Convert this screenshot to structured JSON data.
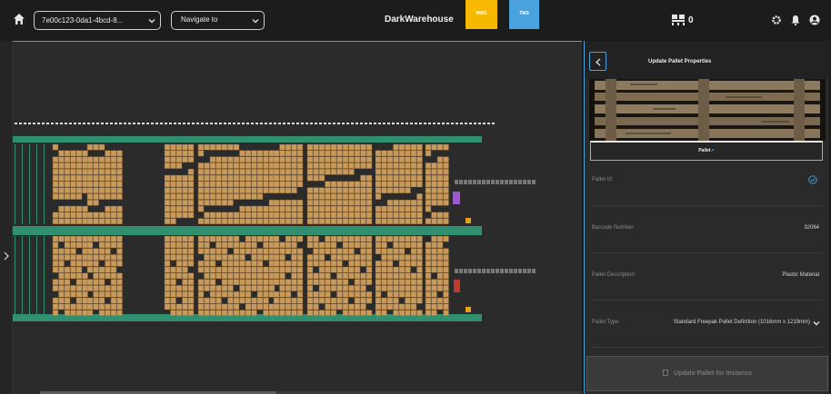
{
  "header": {
    "warehouse_select_value": "7e00c123-0da1-4bcd-8...",
    "navigate_placeholder": "Navigate to",
    "app_title": "DarkWarehouse",
    "wms_label": "WMS",
    "tms_label": "TMS",
    "pallet_count": "0",
    "colors": {
      "wms": "#f6b900",
      "tms": "#4aa3df",
      "accent": "#4aa3df"
    },
    "icons": [
      "home-icon",
      "chevron-down-icon",
      "pallet-stack-icon",
      "gear-icon",
      "bell-icon",
      "account-icon"
    ]
  },
  "viewport": {
    "rail_toggle_icon": "chevron-right-icon",
    "layout_colors": {
      "pallet": "#c89a5c",
      "lane": "#2f8f6f",
      "background": "#2b2b2b"
    }
  },
  "panel": {
    "title": "Update Pallet Properties",
    "back_icon": "chevron-left-icon",
    "tab_label": "Pallet",
    "tab_suffix": "↗",
    "properties": [
      {
        "label": "Pallet Id:",
        "value": "",
        "verified": true
      },
      {
        "label": "Barcode Number:",
        "value": "32064"
      },
      {
        "label": "Pallet Description:",
        "value": "Plastic Material"
      },
      {
        "label": "Pallet Type",
        "value": "Standard Freepak Pallet Definition (1016mm x 1219mm)"
      }
    ],
    "update_button": "Update Pallet for Instance"
  }
}
